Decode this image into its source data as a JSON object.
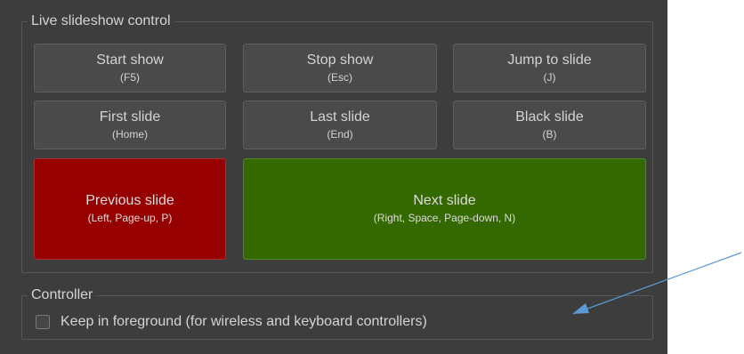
{
  "live_group": {
    "title": "Live slideshow control",
    "buttons": [
      {
        "label": "Start show",
        "hint": "(F5)"
      },
      {
        "label": "Stop show",
        "hint": "(Esc)"
      },
      {
        "label": "Jump to slide",
        "hint": "(J)"
      },
      {
        "label": "First slide",
        "hint": "(Home)"
      },
      {
        "label": "Last slide",
        "hint": "(End)"
      },
      {
        "label": "Black slide",
        "hint": "(B)"
      }
    ],
    "previous": {
      "label": "Previous slide",
      "hint": "(Left, Page-up, P)",
      "color": "#960000"
    },
    "next": {
      "label": "Next slide",
      "hint": "(Right, Space, Page-down, N)",
      "color": "#346800"
    }
  },
  "controller_group": {
    "title": "Controller",
    "checkbox_label": "Keep in foreground (for wireless and keyboard controllers)",
    "checked": false
  },
  "annotation": {
    "type": "arrow",
    "color": "#5b9bd5"
  }
}
